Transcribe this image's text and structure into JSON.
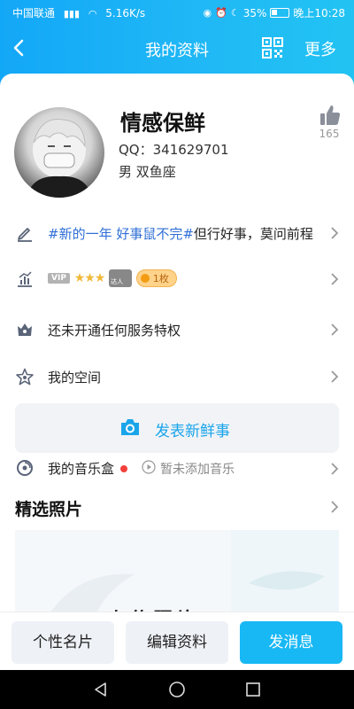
{
  "status_bar": {
    "carrier": "中国联通",
    "network": "4G",
    "speed": "5.16K/s",
    "battery": "35%",
    "time": "晚上10:28"
  },
  "nav": {
    "title": "我的资料",
    "more_label": "更多"
  },
  "profile": {
    "nickname": "情感保鲜",
    "qq": "QQ：341629701",
    "gender_sign": "男  双鱼座",
    "like_count": "165"
  },
  "signature": {
    "highlight": "#新的一年 好事鼠不完#",
    "text": "但行好事，莫问前程"
  },
  "levels": {
    "vip_label": "VIP",
    "stars": "★★★",
    "badge_label": "达人",
    "coin_label": "1枚"
  },
  "rows": {
    "service": "还未开通任何服务特权",
    "space": "我的空间"
  },
  "post_button": {
    "label": "发表新鲜事"
  },
  "music": {
    "label": "我的音乐盒",
    "empty": "暂未添加音乐"
  },
  "photos": {
    "title": "精选照片",
    "upload_label": "上传照片"
  },
  "bottom_buttons": {
    "card": "个性名片",
    "edit": "编辑资料",
    "message": "发消息"
  },
  "colors": {
    "header_start": "#13a7f7",
    "header_end": "#22c3f3",
    "accent": "#1aa5ea",
    "signature_blue": "#2f6fd6",
    "send_button": "#18b8f5"
  }
}
